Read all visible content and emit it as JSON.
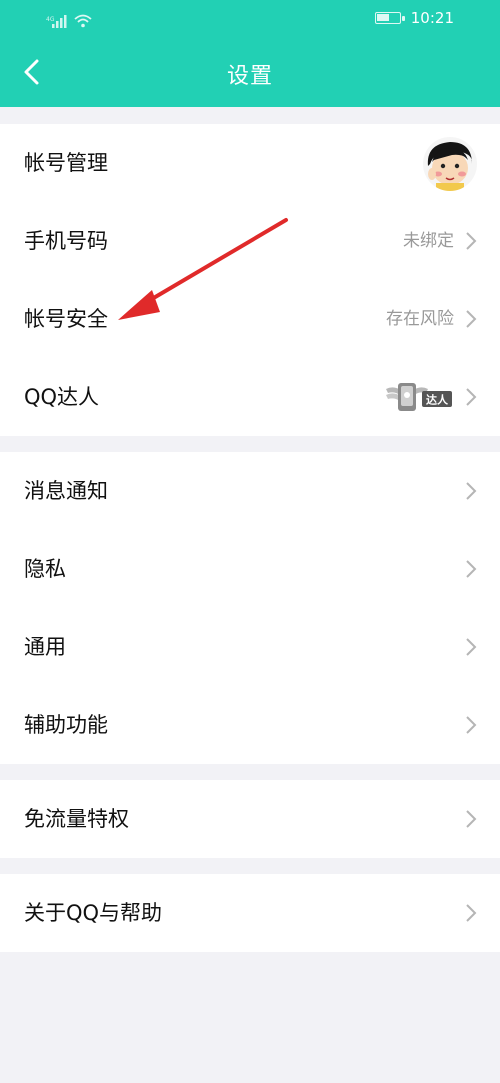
{
  "status_bar": {
    "time": "10:21"
  },
  "header": {
    "title": "设置"
  },
  "groups": [
    {
      "rows": [
        {
          "label": "帐号管理",
          "value": ""
        },
        {
          "label": "手机号码",
          "value": "未绑定"
        },
        {
          "label": "帐号安全",
          "value": "存在风险"
        },
        {
          "label": "QQ达人",
          "value": "",
          "badge_text": "达人"
        }
      ]
    },
    {
      "rows": [
        {
          "label": "消息通知"
        },
        {
          "label": "隐私"
        },
        {
          "label": "通用"
        },
        {
          "label": "辅助功能"
        }
      ]
    },
    {
      "rows": [
        {
          "label": "免流量特权"
        }
      ]
    },
    {
      "rows": [
        {
          "label": "关于QQ与帮助"
        }
      ]
    }
  ],
  "colors": {
    "header_bg": "#22d0b4",
    "annotation_arrow": "#e02a2a",
    "background": "#f2f2f6"
  },
  "icons": [
    "back-chevron-icon",
    "signal-icon",
    "wifi-icon",
    "battery-icon",
    "chevron-right-icon",
    "avatar",
    "qq-daren-badge-icon"
  ]
}
